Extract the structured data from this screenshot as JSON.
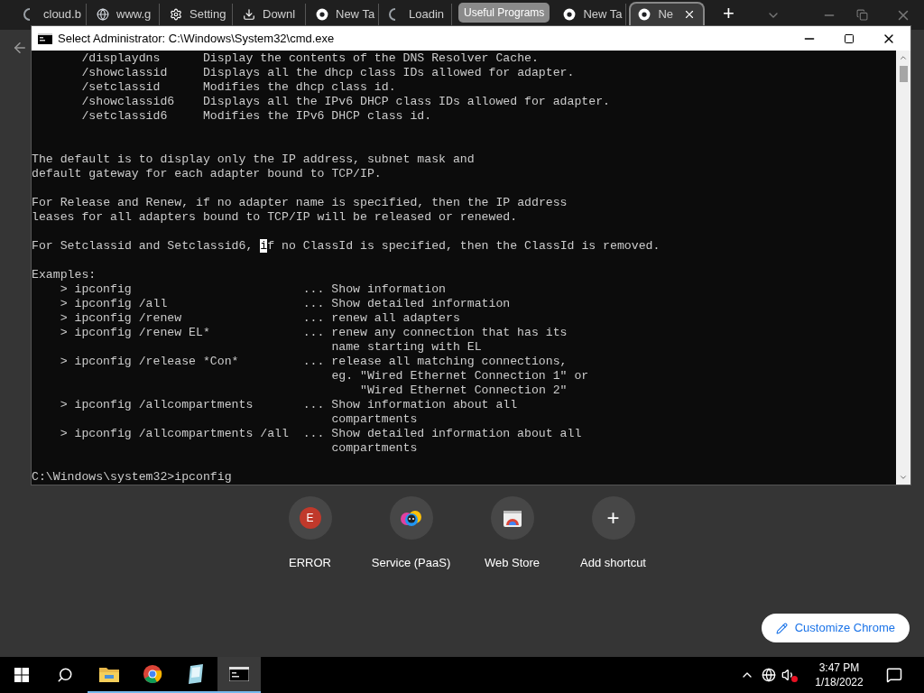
{
  "browser": {
    "tabs": [
      {
        "kind": "loading",
        "title": "cloud.b",
        "selected": false
      },
      {
        "kind": "site",
        "title": "www.g",
        "selected": false
      },
      {
        "kind": "settings",
        "title": "Setting",
        "selected": false
      },
      {
        "kind": "download",
        "title": "Downl",
        "selected": false
      },
      {
        "kind": "newtab",
        "title": "New Ta",
        "selected": false
      },
      {
        "kind": "loading",
        "title": "Loadin",
        "selected": false
      },
      {
        "kind": "group",
        "title": "Useful Programs",
        "selected": false
      },
      {
        "kind": "newtab",
        "title": "New Ta",
        "selected": false
      },
      {
        "kind": "newtab",
        "title": "Ne",
        "selected": true
      }
    ],
    "new_tab_label": "+",
    "shortcuts": [
      {
        "kind": "initial",
        "initial": "E",
        "label": "ERROR",
        "color": "#c0392b"
      },
      {
        "kind": "paas",
        "label": "Service (PaaS)"
      },
      {
        "kind": "store",
        "label": "Web Store"
      },
      {
        "kind": "add",
        "symbol": "+",
        "label": "Add shortcut"
      }
    ],
    "customize_button": "Customize Chrome"
  },
  "console": {
    "title": "Select Administrator: C:\\Windows\\System32\\cmd.exe",
    "rows": [
      {
        "kind": "option",
        "option": "/displaydns",
        "description": "Display the contents of the DNS Resolver Cache."
      },
      {
        "kind": "option",
        "option": "/showclassid",
        "description": "Displays all the dhcp class IDs allowed for adapter."
      },
      {
        "kind": "option",
        "option": "/setclassid",
        "description": "Modifies the dhcp class id."
      },
      {
        "kind": "option",
        "option": "/showclassid6",
        "description": "Displays all the IPv6 DHCP class IDs allowed for adapter."
      },
      {
        "kind": "option",
        "option": "/setclassid6",
        "description": "Modifies the IPv6 DHCP class id."
      },
      {
        "kind": "blank"
      },
      {
        "kind": "blank"
      },
      {
        "kind": "text",
        "text": "The default is to display only the IP address, subnet mask and"
      },
      {
        "kind": "text",
        "text": "default gateway for each adapter bound to TCP/IP."
      },
      {
        "kind": "blank"
      },
      {
        "kind": "text",
        "text": "For Release and Renew, if no adapter name is specified, then the IP address"
      },
      {
        "kind": "text",
        "text": "leases for all adapters bound to TCP/IP will be released or renewed."
      },
      {
        "kind": "blank"
      },
      {
        "kind": "cursor",
        "before": "For Setclassid and Setclassid6, ",
        "cursor": "i",
        "after": "f no ClassId is specified, then the ClassId is removed."
      },
      {
        "kind": "blank"
      },
      {
        "kind": "text",
        "text": "Examples:"
      },
      {
        "kind": "example",
        "command": "> ipconfig",
        "description": "... Show information"
      },
      {
        "kind": "example",
        "command": "> ipconfig /all",
        "description": "... Show detailed information"
      },
      {
        "kind": "example",
        "command": "> ipconfig /renew",
        "description": "... renew all adapters"
      },
      {
        "kind": "example",
        "command": "> ipconfig /renew EL*",
        "description": "... renew any connection that has its"
      },
      {
        "kind": "wrap",
        "description": "name starting with EL"
      },
      {
        "kind": "example",
        "command": "> ipconfig /release *Con*",
        "description": "... release all matching connections,"
      },
      {
        "kind": "wrap",
        "description": "eg. \"Wired Ethernet Connection 1\" or"
      },
      {
        "kind": "subwrap",
        "description": "\"Wired Ethernet Connection 2\""
      },
      {
        "kind": "example",
        "command": "> ipconfig /allcompartments",
        "description": "... Show information about all"
      },
      {
        "kind": "wrap",
        "description": "compartments"
      },
      {
        "kind": "example",
        "command": "> ipconfig /allcompartments /all",
        "description": "... Show detailed information about all"
      },
      {
        "kind": "wrap",
        "description": "compartments"
      },
      {
        "kind": "blank"
      },
      {
        "kind": "text",
        "text": "C:\\Windows\\system32>ipconfig"
      }
    ]
  },
  "taskbar": {
    "apps": [
      {
        "kind": "explorer",
        "running": true,
        "selected": false
      },
      {
        "kind": "browser",
        "running": true,
        "selected": false
      },
      {
        "kind": "notepad",
        "running": true,
        "selected": false
      },
      {
        "kind": "console",
        "running": true,
        "selected": true
      }
    ],
    "time": "3:47 PM",
    "date": "1/18/2022"
  }
}
